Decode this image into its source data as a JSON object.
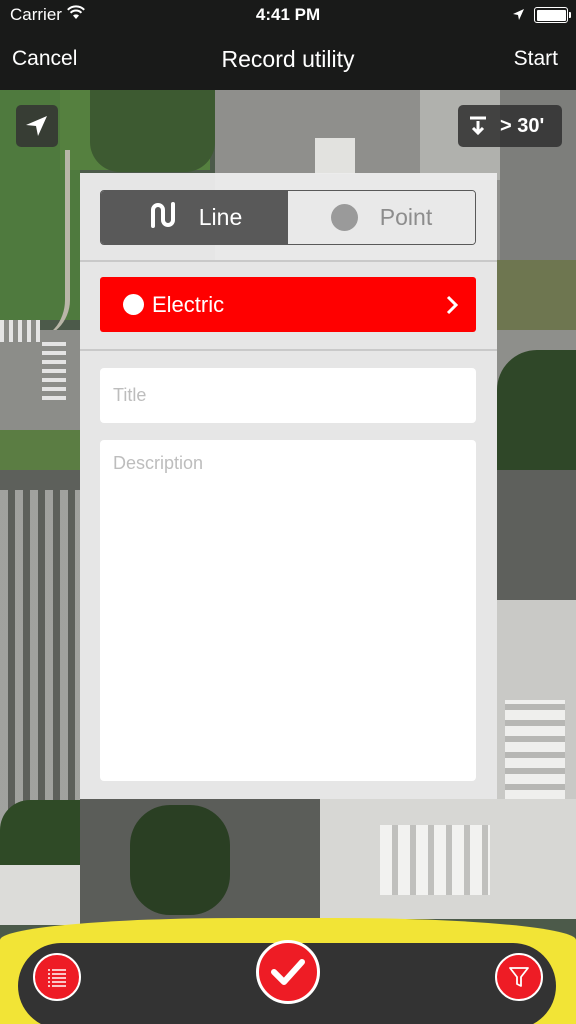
{
  "status_bar": {
    "carrier": "Carrier",
    "time": "4:41 PM",
    "icons": [
      "wifi-icon",
      "location-arrow-icon",
      "battery-icon"
    ]
  },
  "nav": {
    "cancel_label": "Cancel",
    "title": "Record utility",
    "start_label": "Start"
  },
  "map": {
    "locate_icon": "navigation-arrow-icon",
    "depth_badge": {
      "icon": "depth-arrow-icon",
      "value": "> 30'"
    }
  },
  "form": {
    "type_selector": {
      "options": [
        {
          "label": "Line",
          "icon": "line-icon",
          "selected": true
        },
        {
          "label": "Point",
          "icon": "point-icon",
          "selected": false
        }
      ]
    },
    "category": {
      "label": "Electric",
      "color": "#ff0000",
      "icon": "chevron-right-icon"
    },
    "title": {
      "value": "",
      "placeholder": "Title"
    },
    "description": {
      "value": "",
      "placeholder": "Description"
    }
  },
  "bottom_bar": {
    "accent_color": "#f2e436",
    "buttons": [
      {
        "name": "list",
        "icon": "list-icon"
      },
      {
        "name": "confirm",
        "icon": "checkmark-icon"
      },
      {
        "name": "filter",
        "icon": "filter-icon"
      }
    ]
  }
}
